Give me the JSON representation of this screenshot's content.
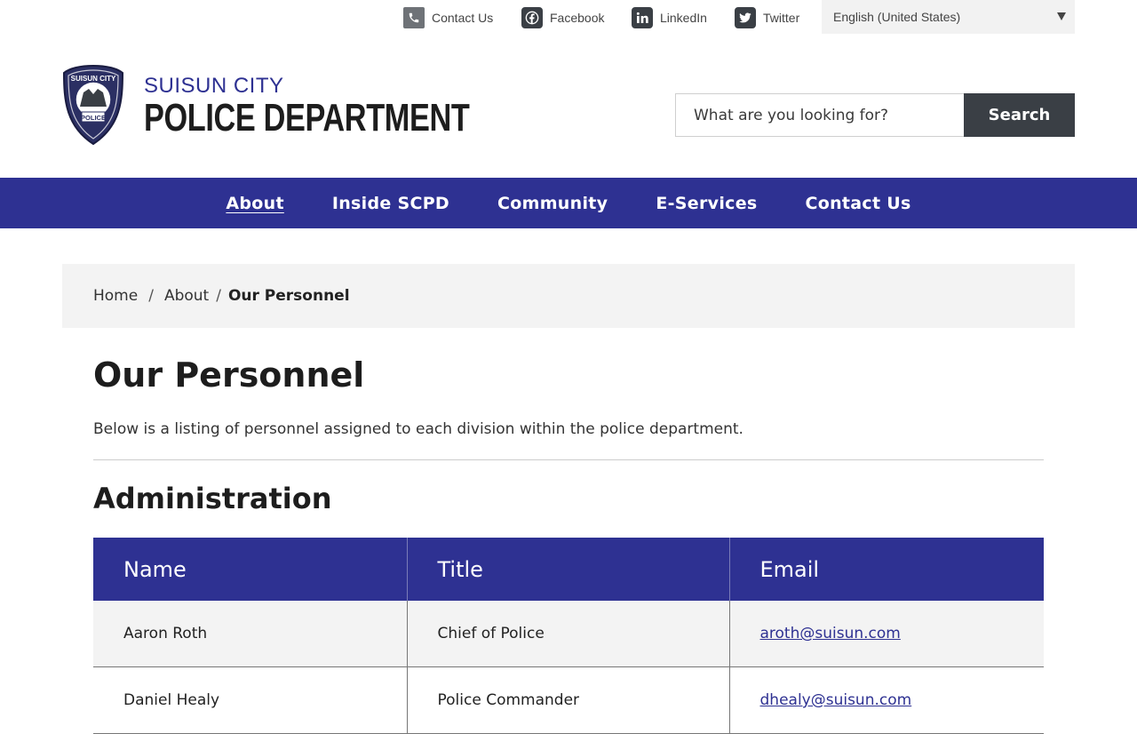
{
  "utility": {
    "links": [
      {
        "label": "Contact Us",
        "icon": "phone-icon"
      },
      {
        "label": "Facebook",
        "icon": "facebook-icon"
      },
      {
        "label": "LinkedIn",
        "icon": "linkedin-icon"
      },
      {
        "label": "Twitter",
        "icon": "twitter-icon"
      }
    ],
    "language": "English (United States)"
  },
  "logo": {
    "city": "SUISUN CITY",
    "department": "POLICE DEPARTMENT",
    "badge_top": "SUISUN CITY",
    "badge_bottom": "POLICE"
  },
  "search": {
    "placeholder": "What are you looking for?",
    "button": "Search"
  },
  "nav": {
    "items": [
      "About",
      "Inside SCPD",
      "Community",
      "E-Services",
      "Contact Us"
    ],
    "active": "About"
  },
  "breadcrumb": {
    "home": "Home",
    "parent": "About",
    "current": "Our Personnel",
    "separator": "/"
  },
  "page": {
    "title": "Our Personnel",
    "intro": "Below is a listing of personnel assigned to each division within the police department."
  },
  "section": {
    "title": "Administration",
    "columns": [
      "Name",
      "Title",
      "Email"
    ],
    "rows": [
      {
        "name": "Aaron Roth",
        "title": "Chief of Police",
        "email": "aroth@suisun.com"
      },
      {
        "name": "Daniel Healy",
        "title": "Police Commander",
        "email": "dhealy@suisun.com"
      }
    ]
  },
  "colors": {
    "brand": "#2e3192",
    "dark": "#3a3f45",
    "breadcrumb_bg": "#f3f3f3"
  }
}
